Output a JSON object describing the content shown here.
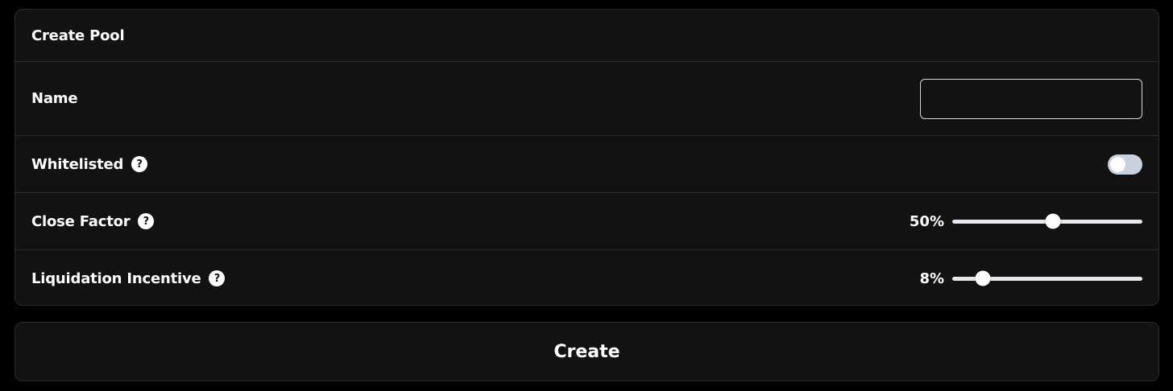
{
  "panel": {
    "title": "Create Pool"
  },
  "fields": {
    "name": {
      "label": "Name",
      "value": "",
      "placeholder": ""
    },
    "whitelisted": {
      "label": "Whitelisted",
      "help_icon": "question-circle-icon",
      "enabled": false
    },
    "close_factor": {
      "label": "Close Factor",
      "help_icon": "question-circle-icon",
      "value_text": "50%",
      "fraction": 0.53
    },
    "liquidation_incentive": {
      "label": "Liquidation Incentive",
      "help_icon": "question-circle-icon",
      "value_text": "8%",
      "fraction": 0.16
    }
  },
  "help_glyph": "?",
  "create_button": {
    "label": "Create"
  },
  "colors": {
    "background": "#000000",
    "panel": "#121212",
    "text": "#ffffff",
    "toggle_track": "#c7d2dc"
  }
}
